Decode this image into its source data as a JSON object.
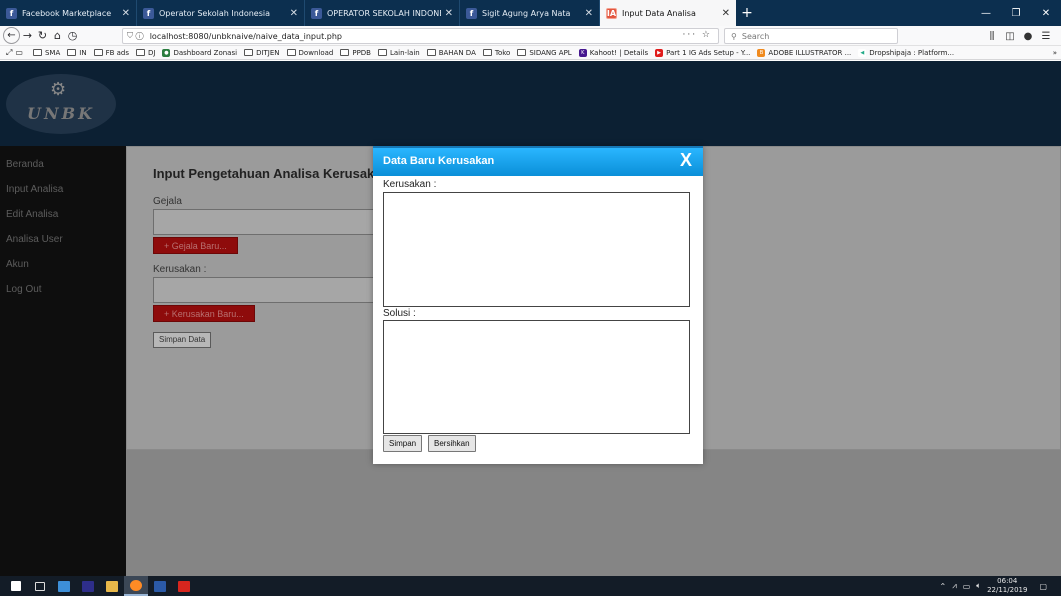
{
  "browser": {
    "tabs": [
      {
        "title": "Facebook Marketplace",
        "favicon": "f",
        "active": false
      },
      {
        "title": "Operator Sekolah Indonesia",
        "favicon": "f",
        "active": false
      },
      {
        "title": "OPERATOR SEKOLAH INDONE",
        "favicon": "f",
        "active": false
      },
      {
        "title": "Sigit Agung Arya Nata",
        "favicon": "f",
        "active": false
      },
      {
        "title": "Input Data Analisa",
        "favicon": "IA",
        "active": true
      }
    ],
    "url": "localhost:8080/unbknaive/naive_data_input.php",
    "search_placeholder": "Search",
    "bookmarks": [
      "SMA",
      "IN",
      "FB ads",
      "DJ",
      "Dashboard Zonasi",
      "DITJEN",
      "Download",
      "PPDB",
      "Lain-lain",
      "BAHAN DA",
      "Toko",
      "SIDANG APL",
      "Kahoot! | Details",
      "Part 1 IG Ads Setup - Y...",
      "ADOBE ILLUSTRATOR ...",
      "Dropshipaja : Platform..."
    ]
  },
  "app": {
    "logo_text": "UNBK",
    "menu": [
      "Beranda",
      "Input Analisa",
      "Edit Analisa",
      "Analisa User",
      "Akun",
      "Log Out"
    ],
    "page_title": "Input Pengetahuan Analisa Kerusaka",
    "form": {
      "gejala_label": "Gejala",
      "gejala_button": "+ Gejala Baru...",
      "kerusakan_label": "Kerusakan :",
      "kerusakan_button": "+ Kerusakan Baru...",
      "save_button": "Simpan Data"
    }
  },
  "modal": {
    "title": "Data Baru Kerusakan",
    "close": "X",
    "kerusakan_label": "Kerusakan :",
    "solusi_label": "Solusi :",
    "save_button": "Simpan",
    "clear_button": "Bersihkan"
  },
  "taskbar": {
    "time": "06:04",
    "date": "22/11/2019"
  },
  "colors": {
    "header": "#0c2033",
    "sidebar": "#0e0e0e",
    "modal_header": "#1a9fe8",
    "accent_button": "#8e0b0b"
  }
}
